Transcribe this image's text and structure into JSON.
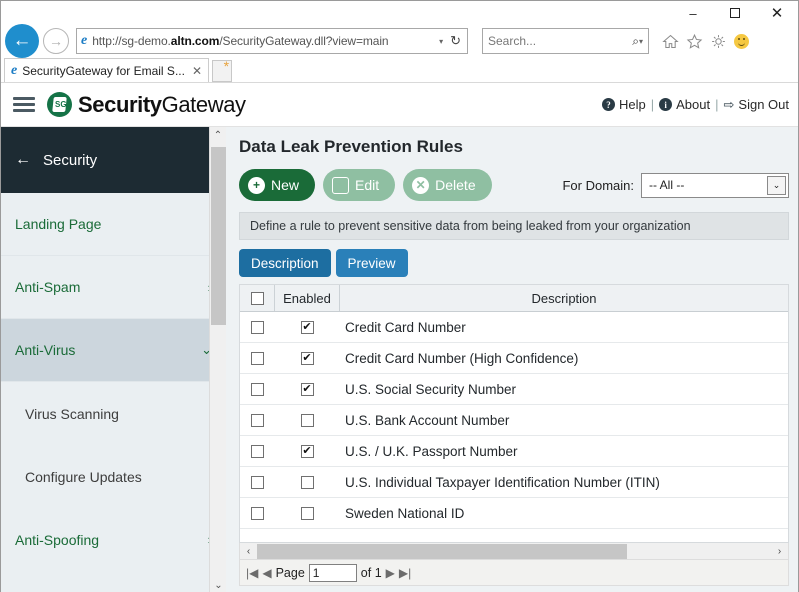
{
  "browser": {
    "window_controls": {
      "minimize": "–",
      "maximize": "▢",
      "close": "✕"
    },
    "back_icon": "←",
    "forward_icon": "→",
    "url": "http://sg-demo.altn.com/SecurityGateway.dll?view=main",
    "url_bold_part": "altn.com",
    "url_prefix": "http://sg-demo.",
    "url_suffix": "/SecurityGateway.dll?view=main",
    "url_dropdown_icon": "▾",
    "refresh_icon": "↻",
    "search_placeholder": "Search...",
    "search_icon": "⌕",
    "search_dropdown_icon": "▾",
    "home_icon": "home-icon",
    "favorites_icon": "star-icon",
    "tools_icon": "gear-icon",
    "feedback_icon": "smiley-icon",
    "tab_title": "SecurityGateway for Email S...",
    "tab_close_icon": "✕",
    "new_tab_icon": "new-tab"
  },
  "app_header": {
    "menu_icon": "hamburger-icon",
    "brand_bold": "Security",
    "brand_regular": "Gateway",
    "links": [
      {
        "label": "Help",
        "icon": "?"
      },
      {
        "label": "About",
        "icon": "i"
      },
      {
        "label": "Sign Out",
        "icon": "⇨"
      }
    ],
    "separator": "|"
  },
  "sidebar": {
    "header": {
      "back_icon": "←",
      "title": "Security"
    },
    "items": [
      {
        "label": "Landing Page",
        "chevron": "",
        "state": "normal",
        "type": "item"
      },
      {
        "label": "Anti-Spam",
        "chevron": "›",
        "state": "normal",
        "type": "item"
      },
      {
        "label": "Anti-Virus",
        "chevron": "⌄",
        "state": "active",
        "type": "item"
      },
      {
        "label": "Virus Scanning",
        "chevron": "",
        "state": "normal",
        "type": "sub"
      },
      {
        "label": "Configure Updates",
        "chevron": "",
        "state": "normal",
        "type": "sub"
      },
      {
        "label": "Anti-Spoofing",
        "chevron": "›",
        "state": "normal",
        "type": "item"
      }
    ],
    "scroll_up_icon": "⌃",
    "scroll_down_icon": "⌄"
  },
  "main": {
    "title": "Data Leak Prevention Rules",
    "toolbar": {
      "new_label": "New",
      "new_icon": "+",
      "edit_label": "Edit",
      "edit_icon": "✎",
      "delete_label": "Delete",
      "delete_icon": "✕",
      "domain_label": "For Domain:",
      "domain_value": "-- All --",
      "domain_dropdown_icon": "⌄"
    },
    "info_text": "Define a rule to prevent sensitive data from being leaked from your organization",
    "tabs": [
      {
        "label": "Description",
        "selected": true
      },
      {
        "label": "Preview",
        "selected": false
      }
    ],
    "table": {
      "columns": [
        "",
        "Enabled",
        "Description"
      ],
      "select_all_checked": false,
      "rows": [
        {
          "selected": false,
          "enabled": true,
          "description": "Credit Card Number"
        },
        {
          "selected": false,
          "enabled": true,
          "description": "Credit Card Number (High Confidence)"
        },
        {
          "selected": false,
          "enabled": true,
          "description": "U.S. Social Security Number"
        },
        {
          "selected": false,
          "enabled": false,
          "description": "U.S. Bank Account Number"
        },
        {
          "selected": false,
          "enabled": true,
          "description": "U.S. / U.K. Passport Number"
        },
        {
          "selected": false,
          "enabled": false,
          "description": "U.S. Individual Taxpayer Identification Number (ITIN)"
        },
        {
          "selected": false,
          "enabled": false,
          "description": "Sweden National ID"
        }
      ],
      "check_glyph": "✔"
    },
    "hscroll": {
      "left_icon": "‹",
      "right_icon": "›"
    },
    "pager": {
      "first_icon": "|◀",
      "prev_icon": "◀",
      "page_label": "Page",
      "page_value": "1",
      "of_label": "of 1",
      "next_icon": "▶",
      "last_icon": "▶|"
    }
  },
  "colors": {
    "brand_green": "#1a6b38",
    "disabled_green": "#8fbfa2",
    "tab_blue": "#2a80b9",
    "tab_blue_selected": "#1d6ea1",
    "sidebar_dark": "#1d2b33",
    "sidebar_bg": "#eaeff2",
    "ie_blue": "#1f8ecd"
  }
}
